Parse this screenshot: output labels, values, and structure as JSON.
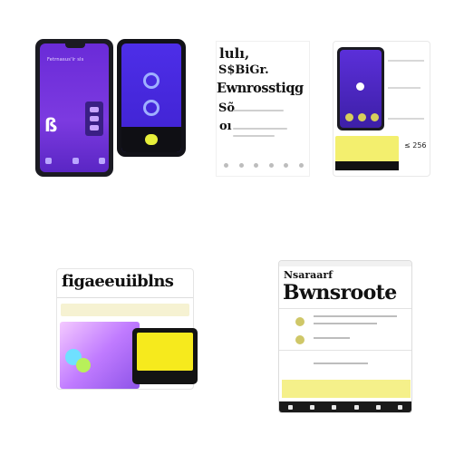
{
  "tiles": {
    "phones": {
      "header_text": "Fetrnasus'lr sls",
      "glyph": "ß"
    },
    "document": {
      "line1": "lulı,",
      "line2": "S$BiGr.",
      "line3": "Ewnrosstiqg",
      "line4": "Sõ",
      "line5": "oı"
    },
    "phone_card": {
      "number": "≤ 256"
    },
    "app_card": {
      "title": "figaeeuiiblns"
    },
    "browser_card": {
      "heading": "Nsaraarf",
      "title": "Bwnsroote"
    }
  },
  "colors": {
    "purple": "#6a2bd8",
    "indigo": "#4d2ee8",
    "yellow": "#f3ef6e",
    "dark": "#1b1b22"
  }
}
